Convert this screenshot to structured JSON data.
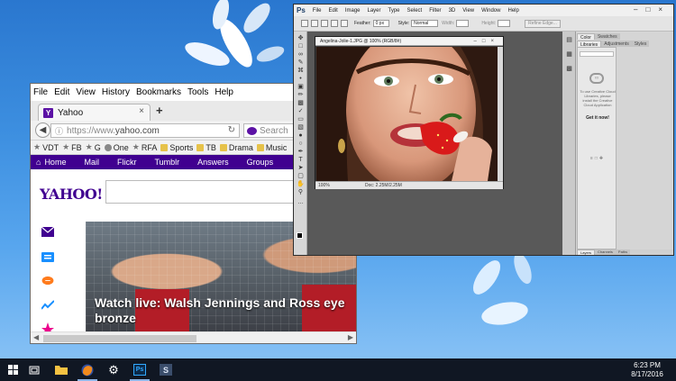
{
  "firefox": {
    "menu": [
      "File",
      "Edit",
      "View",
      "History",
      "Bookmarks",
      "Tools",
      "Help"
    ],
    "tab_title": "Yahoo",
    "tab_close": "×",
    "new_tab": "+",
    "url_proto": "https://www.",
    "url_host": "yahoo.com",
    "search_placeholder": "Search",
    "bookmarks": [
      "VDT",
      "FB",
      "G",
      "One",
      "RFA",
      "Sports",
      "TB",
      "Drama",
      "Music"
    ]
  },
  "yahoo": {
    "nav": [
      "Home",
      "Mail",
      "Flickr",
      "Tumblr",
      "Answers",
      "Groups"
    ],
    "logo": "YAHOO!",
    "headline": "Watch live: Walsh Jennings and Ross eye bronze"
  },
  "photoshop": {
    "logo": "Ps",
    "menu": [
      "File",
      "Edit",
      "Image",
      "Layer",
      "Type",
      "Select",
      "Filter",
      "3D",
      "View",
      "Window",
      "Help"
    ],
    "options": {
      "feather_label": "Feather:",
      "feather_value": "0 px",
      "style_label": "Style:",
      "style_value": "Normal",
      "width_label": "Width:",
      "height_label": "Height:",
      "refine_button": "Refine Edge..."
    },
    "doc_title": "Angelina-Jolie-1.JPG @ 100% (RGB/8#)",
    "zoom": "100%",
    "doc_size": "Doc: 2.25M/2.25M",
    "panel_tabs_top": [
      "Color",
      "Swatches"
    ],
    "panel_tabs_mid": [
      "Libraries",
      "Adjustments",
      "Styles"
    ],
    "libraries_message": "To use Creative Cloud Libraries, please install the Creative Cloud Application",
    "get_it_now": "Get it now!",
    "layers_tabs": [
      "Layers",
      "Channels",
      "Paths"
    ]
  },
  "taskbar": {
    "time": "6:23 PM",
    "date": "8/17/2016"
  },
  "colors": {
    "yahoo_purple": "#400090",
    "taskbar_bg": "#101723",
    "desktop_blue": "#3d8fe0"
  }
}
